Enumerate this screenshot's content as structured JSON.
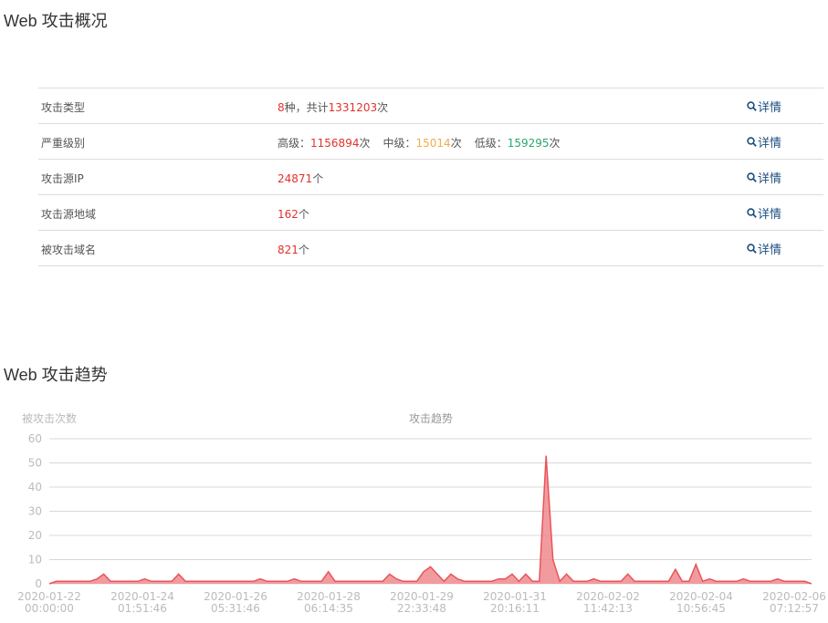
{
  "overview": {
    "title": "Web 攻击概况",
    "detail_label": "详情",
    "rows": [
      {
        "label": "攻击类型",
        "count": "8",
        "count_unit": "种，共计",
        "total": "1331203",
        "total_unit": "次"
      },
      {
        "label": "严重级别",
        "high_label": "高级：",
        "high": "1156894",
        "high_unit": "次",
        "mid_label": "中级：",
        "mid": "15014",
        "mid_unit": "次",
        "low_label": "低级：",
        "low": "159295",
        "low_unit": "次"
      },
      {
        "label": "攻击源IP",
        "value": "24871",
        "unit": "个"
      },
      {
        "label": "攻击源地域",
        "value": "162",
        "unit": "个"
      },
      {
        "label": "被攻击域名",
        "value": "821",
        "unit": "个"
      }
    ]
  },
  "trend": {
    "title": "Web 攻击趋势"
  },
  "chart_data": {
    "type": "area",
    "title": "攻击趋势",
    "ylabel": "被攻击次数",
    "xlabel": "",
    "ylim": [
      0,
      60
    ],
    "yticks": [
      0,
      10,
      20,
      30,
      40,
      50,
      60
    ],
    "grid": true,
    "color": "#e8545a",
    "fill_color": "#f08a8e",
    "x_tick_labels": [
      [
        "2020-01-22",
        "00:00:00"
      ],
      [
        "2020-01-24",
        "01:51:46"
      ],
      [
        "2020-01-26",
        "05:31:46"
      ],
      [
        "2020-01-28",
        "06:14:35"
      ],
      [
        "2020-01-29",
        "22:33:48"
      ],
      [
        "2020-01-31",
        "20:16:11"
      ],
      [
        "2020-02-02",
        "11:42:13"
      ],
      [
        "2020-02-04",
        "10:56:45"
      ],
      [
        "2020-02-06",
        "07:12:57"
      ]
    ],
    "values": [
      0,
      1,
      1,
      1,
      1,
      1,
      1,
      2,
      4,
      1,
      1,
      1,
      1,
      1,
      2,
      1,
      1,
      1,
      1,
      4,
      1,
      1,
      1,
      1,
      1,
      1,
      1,
      1,
      1,
      1,
      1,
      2,
      1,
      1,
      1,
      1,
      2,
      1,
      1,
      1,
      1,
      5,
      1,
      1,
      1,
      1,
      1,
      1,
      1,
      1,
      4,
      2,
      1,
      1,
      1,
      5,
      7,
      4,
      1,
      4,
      2,
      1,
      1,
      1,
      1,
      1,
      2,
      2,
      4,
      1,
      4,
      1,
      1,
      53,
      10,
      1,
      4,
      1,
      1,
      1,
      2,
      1,
      1,
      1,
      1,
      4,
      1,
      1,
      1,
      1,
      1,
      1,
      6,
      1,
      1,
      8,
      1,
      2,
      1,
      1,
      1,
      1,
      2,
      1,
      1,
      1,
      1,
      2,
      1,
      1,
      1,
      1,
      0
    ]
  }
}
